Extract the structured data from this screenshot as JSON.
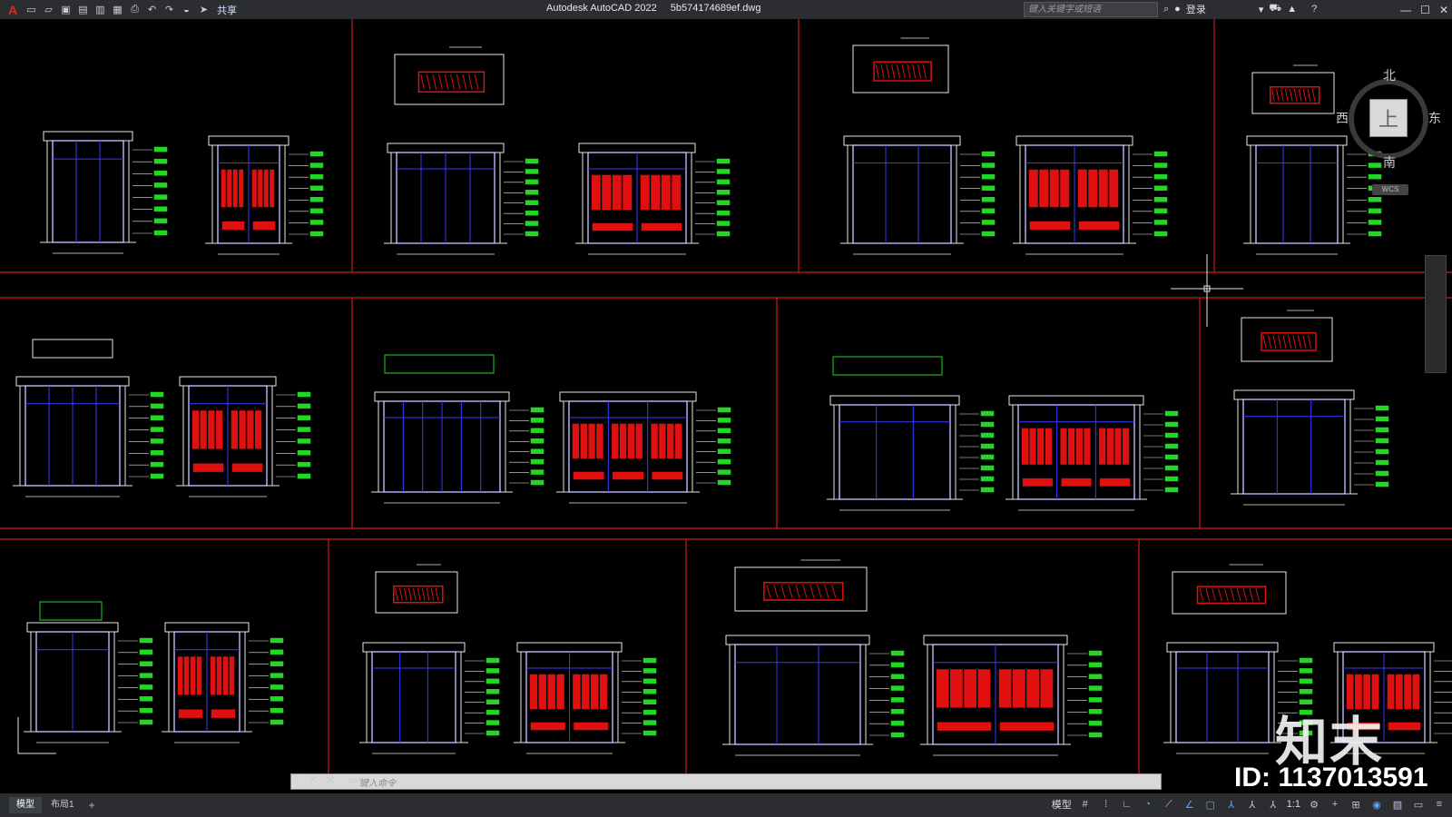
{
  "titlebar": {
    "app_name": "Autodesk AutoCAD 2022",
    "file_name": "5b574174689ef.dwg",
    "share_label": "共享",
    "search_placeholder": "键入关键字或短语",
    "login_label": "登录"
  },
  "viewcube": {
    "top_face": "上",
    "north": "北",
    "south": "南",
    "west": "西",
    "east": "东",
    "wcs_label": "WCS"
  },
  "command": {
    "placeholder": "键入命令"
  },
  "layout_tabs": [
    {
      "label": "模型",
      "active": true
    },
    {
      "label": "布局1",
      "active": false
    }
  ],
  "statusbar": {
    "model_label": "模型",
    "scale_label": "1:1"
  },
  "watermark": {
    "logo_text": "知末",
    "id_text": "ID: 1137013591"
  },
  "colors": {
    "background": "#000000",
    "frame_red": "#d11a1a",
    "line_blue": "#3a3aff",
    "fill_red": "#e01010",
    "dim_green": "#22d822",
    "line_white": "#e6e6e6",
    "ui_dark": "#2b2d31"
  }
}
